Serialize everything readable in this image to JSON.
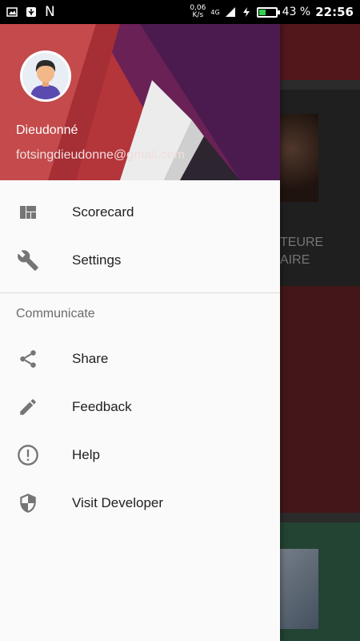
{
  "status_bar": {
    "network_speed": "0,06",
    "network_speed_unit": "K/s",
    "network_type": "4G",
    "battery_percent": "43 %",
    "battery_level": 0.43,
    "time": "22:56",
    "notification_letter": "N"
  },
  "drawer": {
    "user": {
      "name": "Dieudonné",
      "email": "fotsingdieudonne@gmail.com"
    },
    "primary_items": [
      {
        "label": "Scorecard",
        "icon": "dashboard-icon"
      },
      {
        "label": "Settings",
        "icon": "wrench-icon"
      }
    ],
    "section_title": "Communicate",
    "secondary_items": [
      {
        "label": "Share",
        "icon": "share-icon"
      },
      {
        "label": "Feedback",
        "icon": "pencil-icon"
      },
      {
        "label": "Help",
        "icon": "info-icon"
      },
      {
        "label": "Visit Developer",
        "icon": "shield-icon"
      }
    ]
  },
  "background": {
    "card_title_line1": "TEURE",
    "card_title_line2": "AIRE"
  },
  "colors": {
    "header_red": "#b4353a",
    "header_purple": "#4b1b4f",
    "toolbar": "#6d1f23",
    "battery_green": "#2fd14a"
  }
}
